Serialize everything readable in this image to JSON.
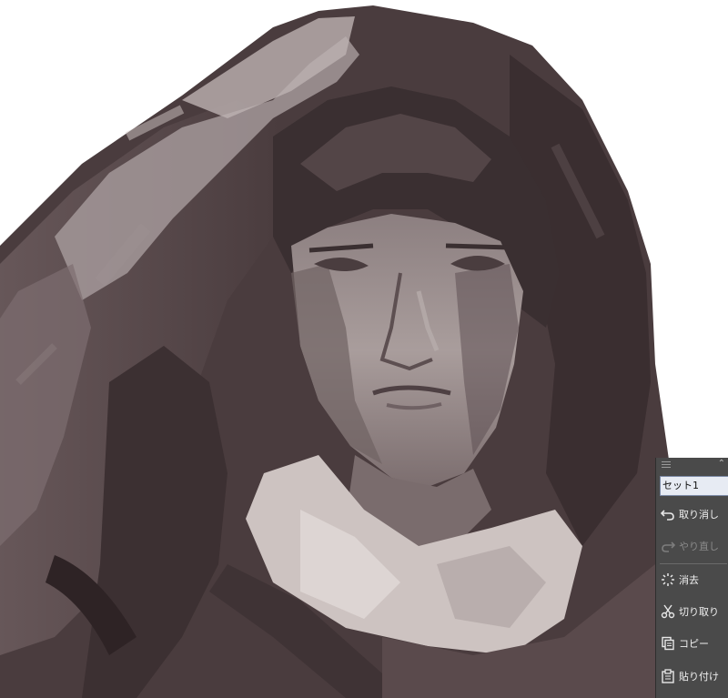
{
  "panel": {
    "set_label": "セット1",
    "commands": [
      {
        "label": "取り消し",
        "icon": "undo-icon",
        "enabled": true
      },
      {
        "label": "やり直し",
        "icon": "redo-icon",
        "enabled": false
      },
      {
        "label": "消去",
        "icon": "clear-icon",
        "enabled": true
      },
      {
        "label": "切り取り",
        "icon": "scissors-icon",
        "enabled": true
      },
      {
        "label": "コピー",
        "icon": "copy-icon",
        "enabled": true
      },
      {
        "label": "貼り付け",
        "icon": "paste-icon",
        "enabled": true
      }
    ]
  },
  "colors": {
    "canvas_bg": "#ffffff",
    "panel_bg": "#4a4a4a",
    "paint_dark": "#3e3233",
    "paint_mid": "#6e5f60",
    "paint_light": "#c9bfbd"
  }
}
